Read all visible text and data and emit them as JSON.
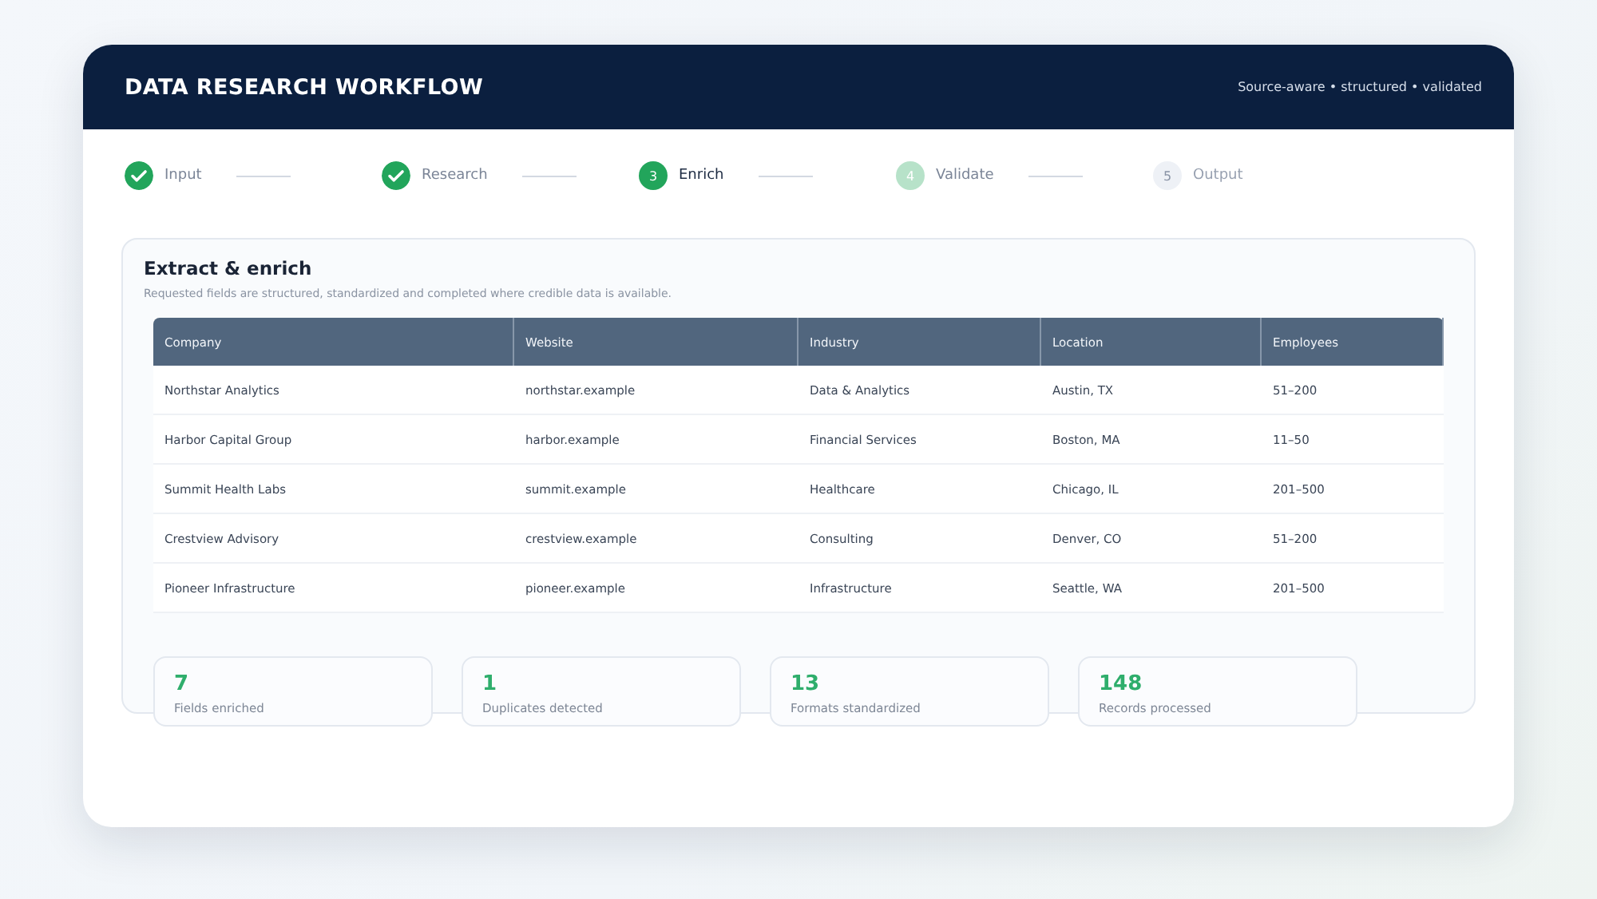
{
  "header": {
    "title": "DATA RESEARCH WORKFLOW",
    "tagline": "Source-aware • structured • validated"
  },
  "steps": [
    {
      "label": "Input",
      "completed": true,
      "selected": false,
      "next": false
    },
    {
      "label": "Research",
      "completed": true,
      "selected": false,
      "next": false
    },
    {
      "number": "3",
      "label": "Enrich",
      "completed": false,
      "selected": true,
      "next": false
    },
    {
      "number": "4",
      "label": "Validate",
      "completed": false,
      "selected": false,
      "next": true
    },
    {
      "number": "5",
      "label": "Output",
      "completed": false,
      "selected": false,
      "next": false
    }
  ],
  "panel": {
    "title": "Extract & enrich",
    "subtitle": "Requested fields are structured, standardized and completed where credible data is available."
  },
  "table": {
    "columns": [
      "Company",
      "Website",
      "Industry",
      "Location",
      "Employees"
    ],
    "rows": [
      [
        "Northstar Analytics",
        "northstar.example",
        "Data & Analytics",
        "Austin, TX",
        "51–200"
      ],
      [
        "Harbor Capital Group",
        "harbor.example",
        "Financial Services",
        "Boston, MA",
        "11–50"
      ],
      [
        "Summit Health Labs",
        "summit.example",
        "Healthcare",
        "Chicago, IL",
        "201–500"
      ],
      [
        "Crestview Advisory",
        "crestview.example",
        "Consulting",
        "Denver, CO",
        "51–200"
      ],
      [
        "Pioneer Infrastructure",
        "pioneer.example",
        "Infrastructure",
        "Seattle, WA",
        "201–500"
      ]
    ]
  },
  "stats": [
    {
      "value": "7",
      "label": "Fields enriched"
    },
    {
      "value": "1",
      "label": "Duplicates detected"
    },
    {
      "value": "13",
      "label": "Formats standardized"
    },
    {
      "value": "148",
      "label": "Records processed"
    }
  ]
}
